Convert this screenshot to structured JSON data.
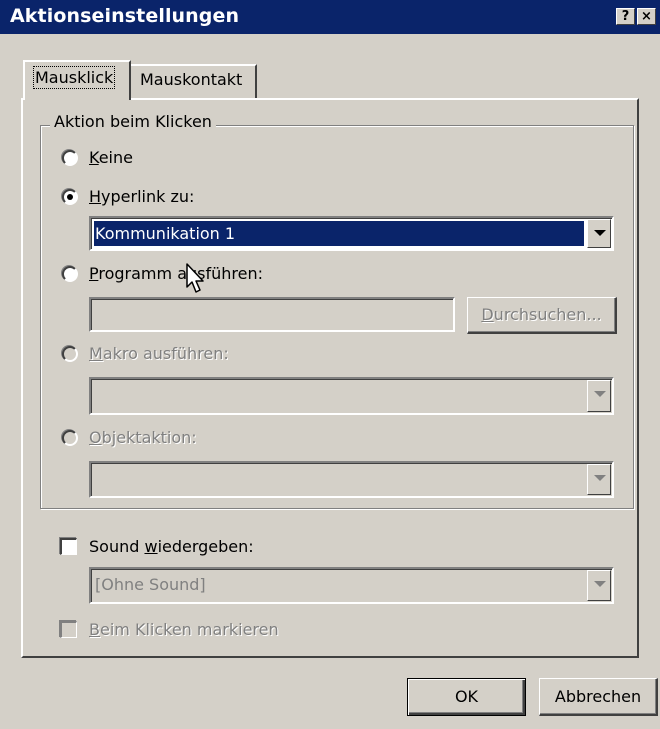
{
  "window": {
    "title": "Aktionseinstellungen",
    "help_button": "?",
    "close_button": "×"
  },
  "tabs": [
    {
      "label": "Mausklick",
      "active": true
    },
    {
      "label": "Mauskontakt",
      "active": false
    }
  ],
  "action_group": {
    "title": "Aktion beim Klicken",
    "options": {
      "none": {
        "label_pre": "",
        "accel": "K",
        "label_post": "eine",
        "checked": false,
        "enabled": true
      },
      "hyperlink": {
        "label_pre": "",
        "accel": "H",
        "label_post": "yperlink zu:",
        "checked": true,
        "enabled": true
      },
      "program": {
        "label_pre": "",
        "accel": "P",
        "label_post": "rogramm ausführen:",
        "checked": false,
        "enabled": true
      },
      "macro": {
        "label_pre": "",
        "accel": "M",
        "label_post": "akro ausführen:",
        "checked": false,
        "enabled": false
      },
      "object": {
        "label_pre": "",
        "accel": "O",
        "label_post": "bjektaktion:",
        "checked": false,
        "enabled": false
      }
    },
    "hyperlink_select": {
      "value": "Kommunikation 1"
    },
    "program_input": {
      "value": ""
    },
    "browse_button": {
      "accel": "D",
      "label_post": "urchsuchen..."
    },
    "macro_select": {
      "value": ""
    },
    "object_select": {
      "value": ""
    }
  },
  "sound": {
    "label_pre": "Sound ",
    "accel": "w",
    "label_post": "iedergeben:",
    "checked": false,
    "select_value": "[Ohne Sound]"
  },
  "highlight": {
    "accel": "B",
    "label_post": "eim Klicken markieren",
    "checked": false,
    "enabled": false
  },
  "buttons": {
    "ok": "OK",
    "cancel": "Abbrechen"
  },
  "colors": {
    "title_bar": "#0a246a",
    "face": "#d4d0c8",
    "selection": "#0a246a"
  }
}
